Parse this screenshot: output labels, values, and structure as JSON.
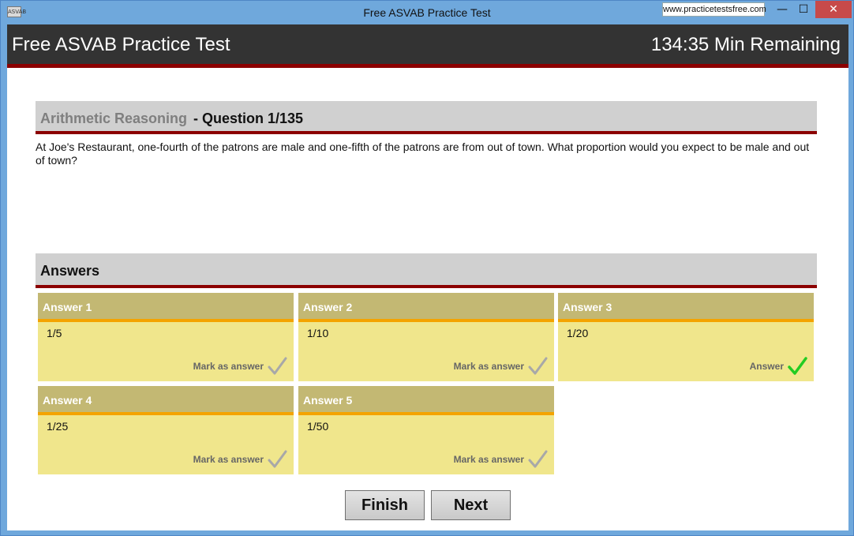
{
  "window": {
    "title": "Free ASVAB Practice Test",
    "icon_text": "ASVAB",
    "site_link": "www.practicetestsfree.com",
    "controls": {
      "minimize": "—",
      "maximize": "☐",
      "close": "✕"
    }
  },
  "header": {
    "app_title": "Free ASVAB Practice Test",
    "time_remaining": "134:35 Min Remaining"
  },
  "question": {
    "category": "Arithmetic Reasoning",
    "separator": " - ",
    "number_label": "Question 1/135",
    "text": "At Joe's Restaurant, one-fourth of the patrons are male and one-fifth of the patrons are from out of town. What proportion would you expect to be male and out of town?"
  },
  "answers": {
    "section_label": "Answers",
    "items": [
      {
        "title": "Answer 1",
        "value": "1/5",
        "mark_label": "Mark as answer",
        "selected": false
      },
      {
        "title": "Answer 2",
        "value": "1/10",
        "mark_label": "Mark as answer",
        "selected": false
      },
      {
        "title": "Answer 3",
        "value": "1/20",
        "mark_label": "Answer",
        "selected": true
      },
      {
        "title": "Answer 4",
        "value": "1/25",
        "mark_label": "Mark as answer",
        "selected": false
      },
      {
        "title": "Answer 5",
        "value": "1/50",
        "mark_label": "Mark as answer",
        "selected": false
      }
    ]
  },
  "nav": {
    "finish_label": "Finish",
    "next_label": "Next"
  },
  "colors": {
    "header_bg": "#333333",
    "accent_red": "#8b0000",
    "card_bg": "#f0e68c",
    "card_title_bg": "#c3b873",
    "card_title_line": "#f4a300",
    "check_unselected": "#a8a8a8",
    "check_selected": "#22cc22"
  }
}
